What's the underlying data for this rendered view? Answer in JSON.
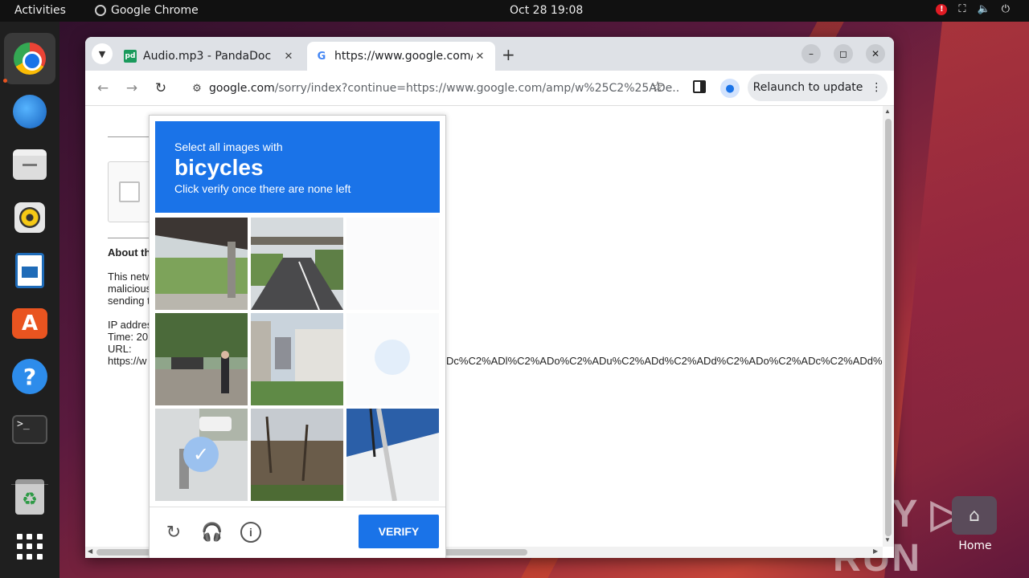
{
  "topbar": {
    "activities": "Activities",
    "app_name": "Google Chrome",
    "clock": "Oct 28  19:08",
    "alert": "!"
  },
  "dock": {
    "items": [
      "chrome-icon",
      "thunderbird-icon",
      "files-icon",
      "rhythmbox-icon",
      "writer-icon",
      "app-center-icon",
      "help-icon",
      "terminal-icon",
      "trash-icon",
      "apps-grid-icon"
    ],
    "terminal_glyph": ">_",
    "store_glyph": "A",
    "help_glyph": "?",
    "trash_glyph": "♻"
  },
  "desktop": {
    "home_label": "Home",
    "watermark": "ANY ▷ RUN"
  },
  "browser": {
    "tabs": [
      {
        "title": "Audio.mp3 - PandaDoc",
        "favicon": "pd"
      },
      {
        "title": "https://www.google.com/",
        "favicon": "G"
      }
    ],
    "new_tab": "+",
    "url_host": "google.com",
    "url_rest": "/sorry/index?continue=https://www.google.com/amp/w%25C2%25ADe...",
    "relaunch_label": "Relaunch to update",
    "menu_glyph": "⋮"
  },
  "page": {
    "about_heading": "About th",
    "para_lines": [
      "This netw",
      "malicious",
      "sending t"
    ],
    "info_lines": [
      "IP addres",
      "Time: 20",
      "URL:",
      "https://w"
    ],
    "url_tail": "Dc%C2%ADl%C2%ADo%C2%ADu%C2%ADd%C2%ADd%C2%ADo%C2%ADc%C2%ADd%"
  },
  "captcha": {
    "line1": "Select all images with",
    "target": "bicycles",
    "line3": "Click verify once there are none left",
    "verify_label": "VERIFY",
    "check_glyph": "✓",
    "tiles": [
      {
        "scene": "overpass-trees",
        "state": "normal"
      },
      {
        "scene": "road-bridge",
        "state": "normal"
      },
      {
        "scene": "blank",
        "state": "loading"
      },
      {
        "scene": "street-pedestrian",
        "state": "normal"
      },
      {
        "scene": "city-building",
        "state": "normal"
      },
      {
        "scene": "blank-selected",
        "state": "loading"
      },
      {
        "scene": "street-car",
        "state": "selected"
      },
      {
        "scene": "bare-trees",
        "state": "normal"
      },
      {
        "scene": "boat-rail",
        "state": "normal"
      }
    ]
  }
}
